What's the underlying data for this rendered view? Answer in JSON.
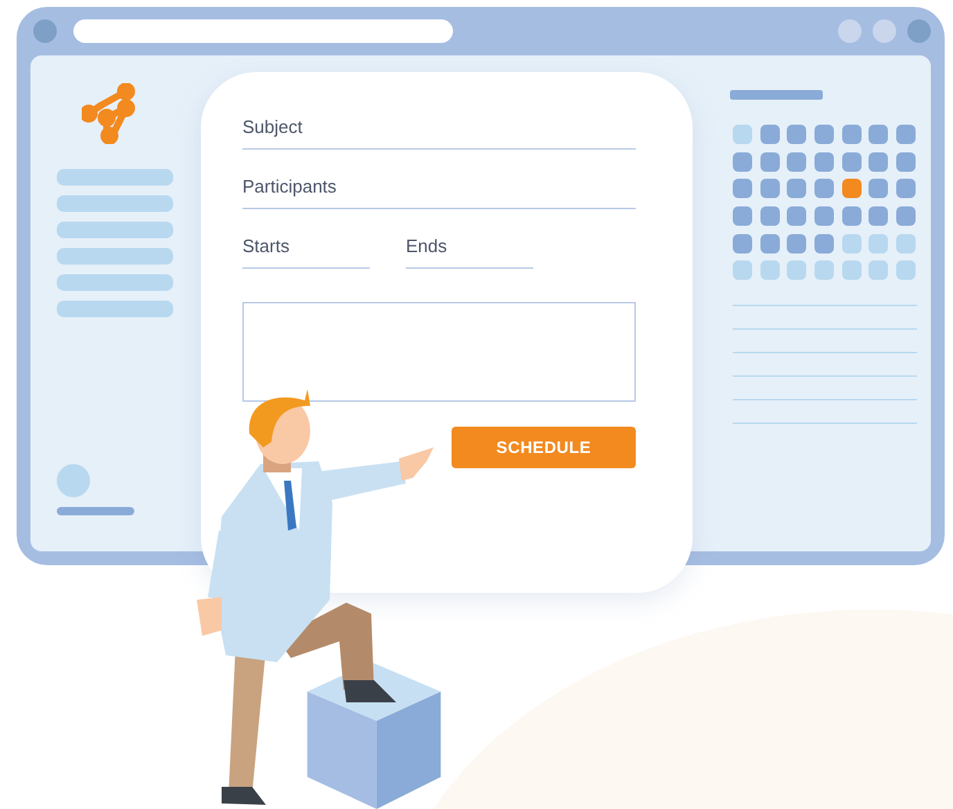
{
  "form": {
    "fields": [
      {
        "kind": "wide",
        "placeholder": "Subject"
      },
      {
        "kind": "wide",
        "placeholder": "Participants"
      },
      {
        "kind": "half",
        "placeholder": "Starts"
      },
      {
        "kind": "half",
        "placeholder": "Ends"
      },
      {
        "kind": "area"
      }
    ],
    "button": "SCHEDULE"
  },
  "calendar": {
    "days": [
      {
        "color": "#b8d8ef"
      },
      {
        "color": "#8aabd8"
      },
      {
        "color": "#8aabd8"
      },
      {
        "color": "#8aabd8"
      },
      {
        "color": "#8aabd8"
      },
      {
        "color": "#8aabd8"
      },
      {
        "color": "#8aabd8"
      },
      {
        "color": "#8aabd8"
      },
      {
        "color": "#8aabd8"
      },
      {
        "color": "#8aabd8"
      },
      {
        "color": "#8aabd8"
      },
      {
        "color": "#8aabd8"
      },
      {
        "color": "#8aabd8"
      },
      {
        "color": "#8aabd8"
      },
      {
        "color": "#8aabd8"
      },
      {
        "color": "#8aabd8"
      },
      {
        "color": "#8aabd8"
      },
      {
        "color": "#8aabd8"
      },
      {
        "color": "#f28a20"
      },
      {
        "color": "#8aabd8"
      },
      {
        "color": "#8aabd8"
      },
      {
        "color": "#8aabd8"
      },
      {
        "color": "#8aabd8"
      },
      {
        "color": "#8aabd8"
      },
      {
        "color": "#8aabd8"
      },
      {
        "color": "#8aabd8"
      },
      {
        "color": "#8aabd8"
      },
      {
        "color": "#8aabd8"
      },
      {
        "color": "#8aabd8"
      },
      {
        "color": "#8aabd8"
      },
      {
        "color": "#8aabd8"
      },
      {
        "color": "#8aabd8"
      },
      {
        "color": "#b8d8ef"
      },
      {
        "color": "#b8d8ef"
      },
      {
        "color": "#b8d8ef"
      },
      {
        "color": "#b8d8ef"
      },
      {
        "color": "#b8d8ef"
      },
      {
        "color": "#b8d8ef"
      },
      {
        "color": "#b8d8ef"
      },
      {
        "color": "#b8d8ef"
      },
      {
        "color": "#b8d8ef"
      },
      {
        "color": "#b8d8ef"
      }
    ]
  }
}
